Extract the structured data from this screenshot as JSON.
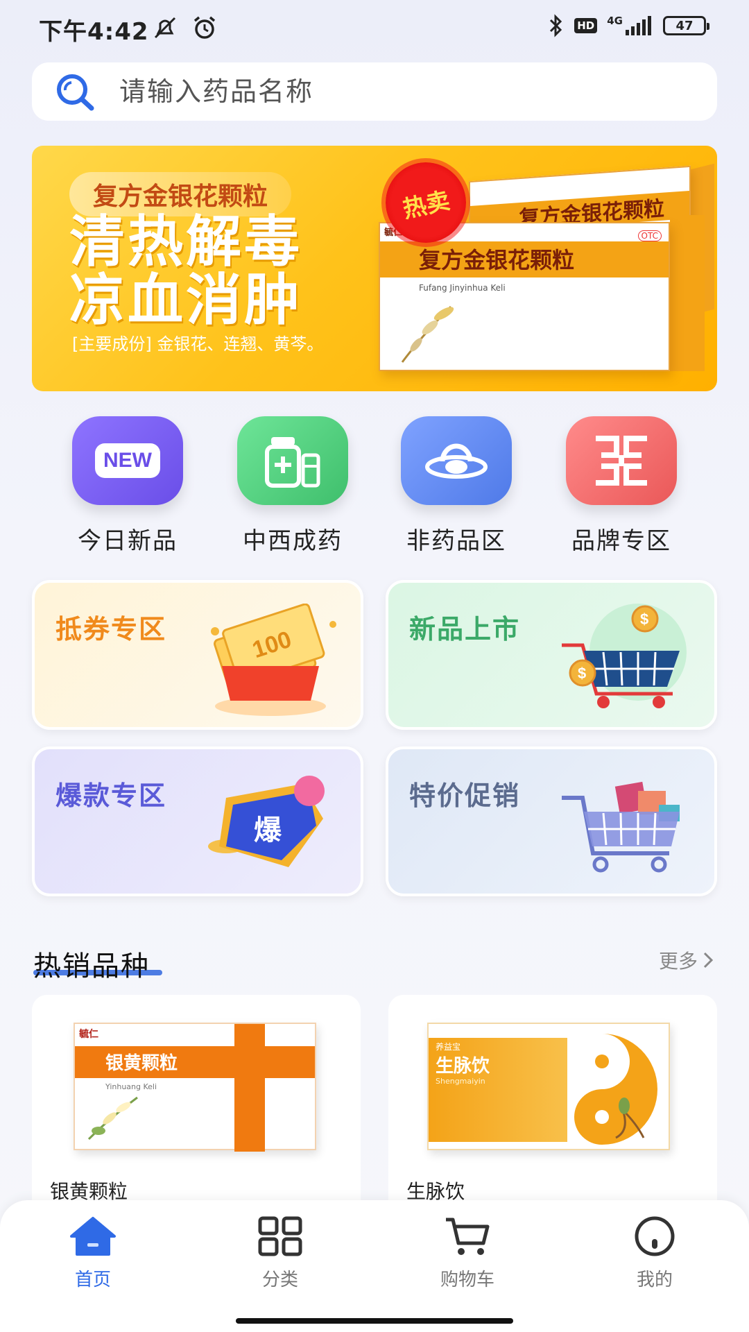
{
  "status_bar": {
    "time": "下午4:42",
    "network": "4G",
    "hd": "HD",
    "battery": "47"
  },
  "search": {
    "placeholder": "请输入药品名称"
  },
  "banner": {
    "tag": "复方金银花颗粒",
    "headline_line1": "清热解毒",
    "headline_line2": "凉血消肿",
    "ingredients": "[主要成份] 金银花、连翘、黄芩。",
    "hot_badge": "热卖",
    "product_name": "复方金银花颗粒",
    "product_pinyin": "Fufang Jinyinhua Keli",
    "otc": "OTC",
    "brand": "毓仁",
    "colors": {
      "background": "#ffc21a",
      "badge": "#f11a1a"
    }
  },
  "shortcuts": [
    {
      "label": "今日新品",
      "icon": "new-icon",
      "color": "#7b5ff0",
      "icon_text": "NEW"
    },
    {
      "label": "中西成药",
      "icon": "medicine-icon",
      "color": "#4fcf7a"
    },
    {
      "label": "非药品区",
      "icon": "ufo-icon",
      "color": "#5b86f0"
    },
    {
      "label": "品牌专区",
      "icon": "brand-icon",
      "color": "#f26b6b"
    }
  ],
  "promos": [
    {
      "title": "抵券专区",
      "title_color": "#f08a1c",
      "icon": "coupon-icon",
      "coupon_value": "100"
    },
    {
      "title": "新品上市",
      "title_color": "#3ba968",
      "icon": "shopping-cart-icon"
    },
    {
      "title": "爆款专区",
      "title_color": "#5a5ad8",
      "icon": "hot-sale-icon",
      "badge_text": "爆"
    },
    {
      "title": "特价促销",
      "title_color": "#5b6b8e",
      "icon": "shopping-cart-icon"
    }
  ],
  "section": {
    "title": "热销品种",
    "more": "更多"
  },
  "products": [
    {
      "name": "银黄颗粒",
      "box_title": "银黄颗粒",
      "box_pinyin": "Yinhuang Keli",
      "brand": "毓仁",
      "color": "#f07a10"
    },
    {
      "name": "生脉饮",
      "box_title": "生脉饮",
      "box_pinyin": "Shengmaiyin",
      "brand": "养益宝",
      "color": "#f4a318"
    }
  ],
  "bottom_nav": [
    {
      "label": "首页",
      "icon": "home-icon",
      "active": true
    },
    {
      "label": "分类",
      "icon": "category-icon",
      "active": false
    },
    {
      "label": "购物车",
      "icon": "cart-icon",
      "active": false
    },
    {
      "label": "我的",
      "icon": "profile-icon",
      "active": false
    }
  ],
  "colors": {
    "accent": "#2f6ae6",
    "inactive": "#777777"
  }
}
